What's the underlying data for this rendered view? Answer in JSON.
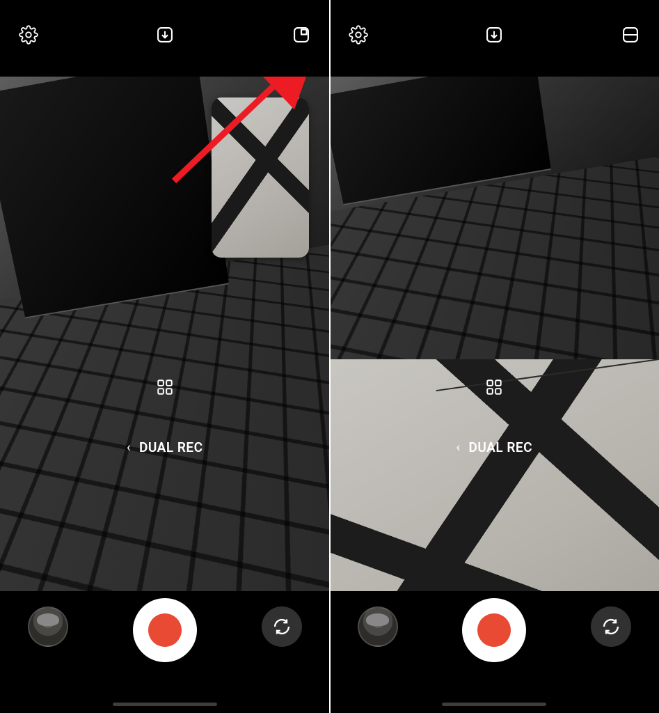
{
  "left": {
    "topbar": {
      "settings_icon": "settings",
      "download_icon": "download",
      "layout_icon": "pip-layout"
    },
    "pip_overlay": true,
    "quad_icon": "grid-apps",
    "mode": {
      "chevron": "‹",
      "label": "DUAL REC"
    },
    "bottom": {
      "gallery": "last-capture-thumbnail",
      "record": "record",
      "switch": "switch-camera"
    }
  },
  "right": {
    "topbar": {
      "settings_icon": "settings",
      "download_icon": "download",
      "layout_icon": "split-layout"
    },
    "split_view": true,
    "quad_icon": "grid-apps",
    "mode": {
      "chevron": "‹",
      "label": "DUAL REC"
    },
    "bottom": {
      "gallery": "last-capture-thumbnail",
      "record": "record",
      "switch": "switch-camera"
    }
  },
  "annotation": {
    "arrow_color": "#ed1c24"
  }
}
